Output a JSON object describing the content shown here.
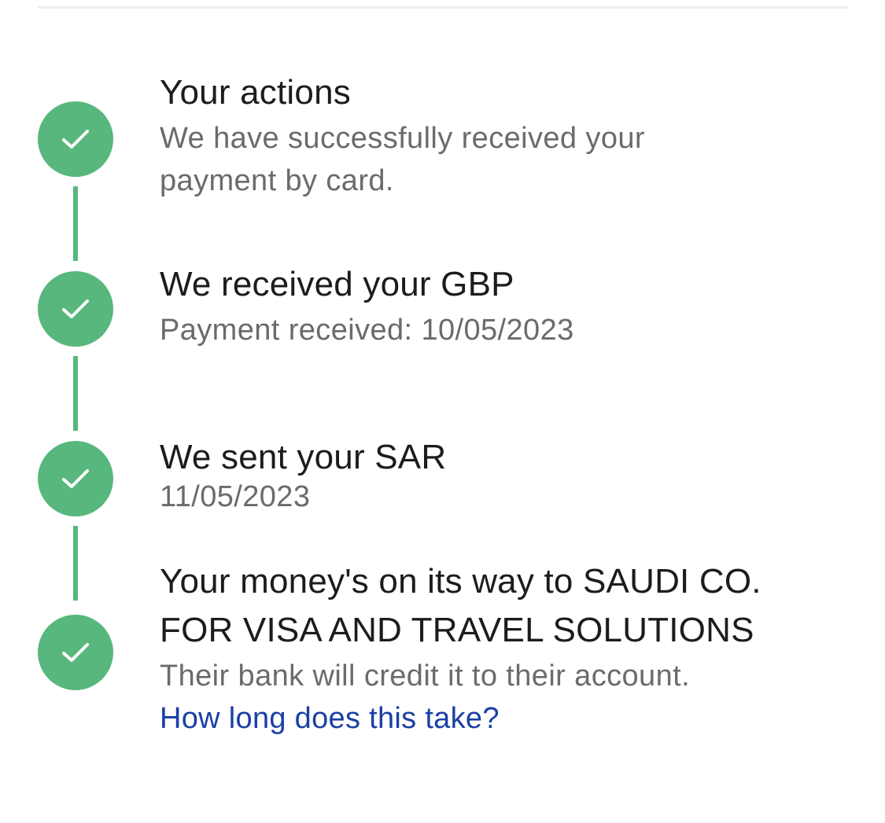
{
  "colors": {
    "accent_green": "#58b77c",
    "title_text": "#1c1c1c",
    "sub_text": "#6b6b6b",
    "link": "#1a3fa5"
  },
  "timeline": [
    {
      "icon": "checkmark-icon",
      "status": "complete",
      "title": "Your actions",
      "subtitle_line1": "We have successfully received your",
      "subtitle_line2": "payment by card."
    },
    {
      "icon": "checkmark-icon",
      "status": "complete",
      "title": "We received your GBP",
      "subtitle_line1": "Payment received: 10/05/2023"
    },
    {
      "icon": "checkmark-icon",
      "status": "complete",
      "title": "We sent your SAR",
      "subtitle_line1": "11/05/2023"
    },
    {
      "icon": "checkmark-icon",
      "status": "complete",
      "title_line1": "Your money's on its way to SAUDI CO.",
      "title_line2": "FOR VISA AND TRAVEL SOLUTIONS",
      "subtitle_line1": "Their bank will credit it to their account.",
      "link_label": "How long does this take?"
    }
  ]
}
